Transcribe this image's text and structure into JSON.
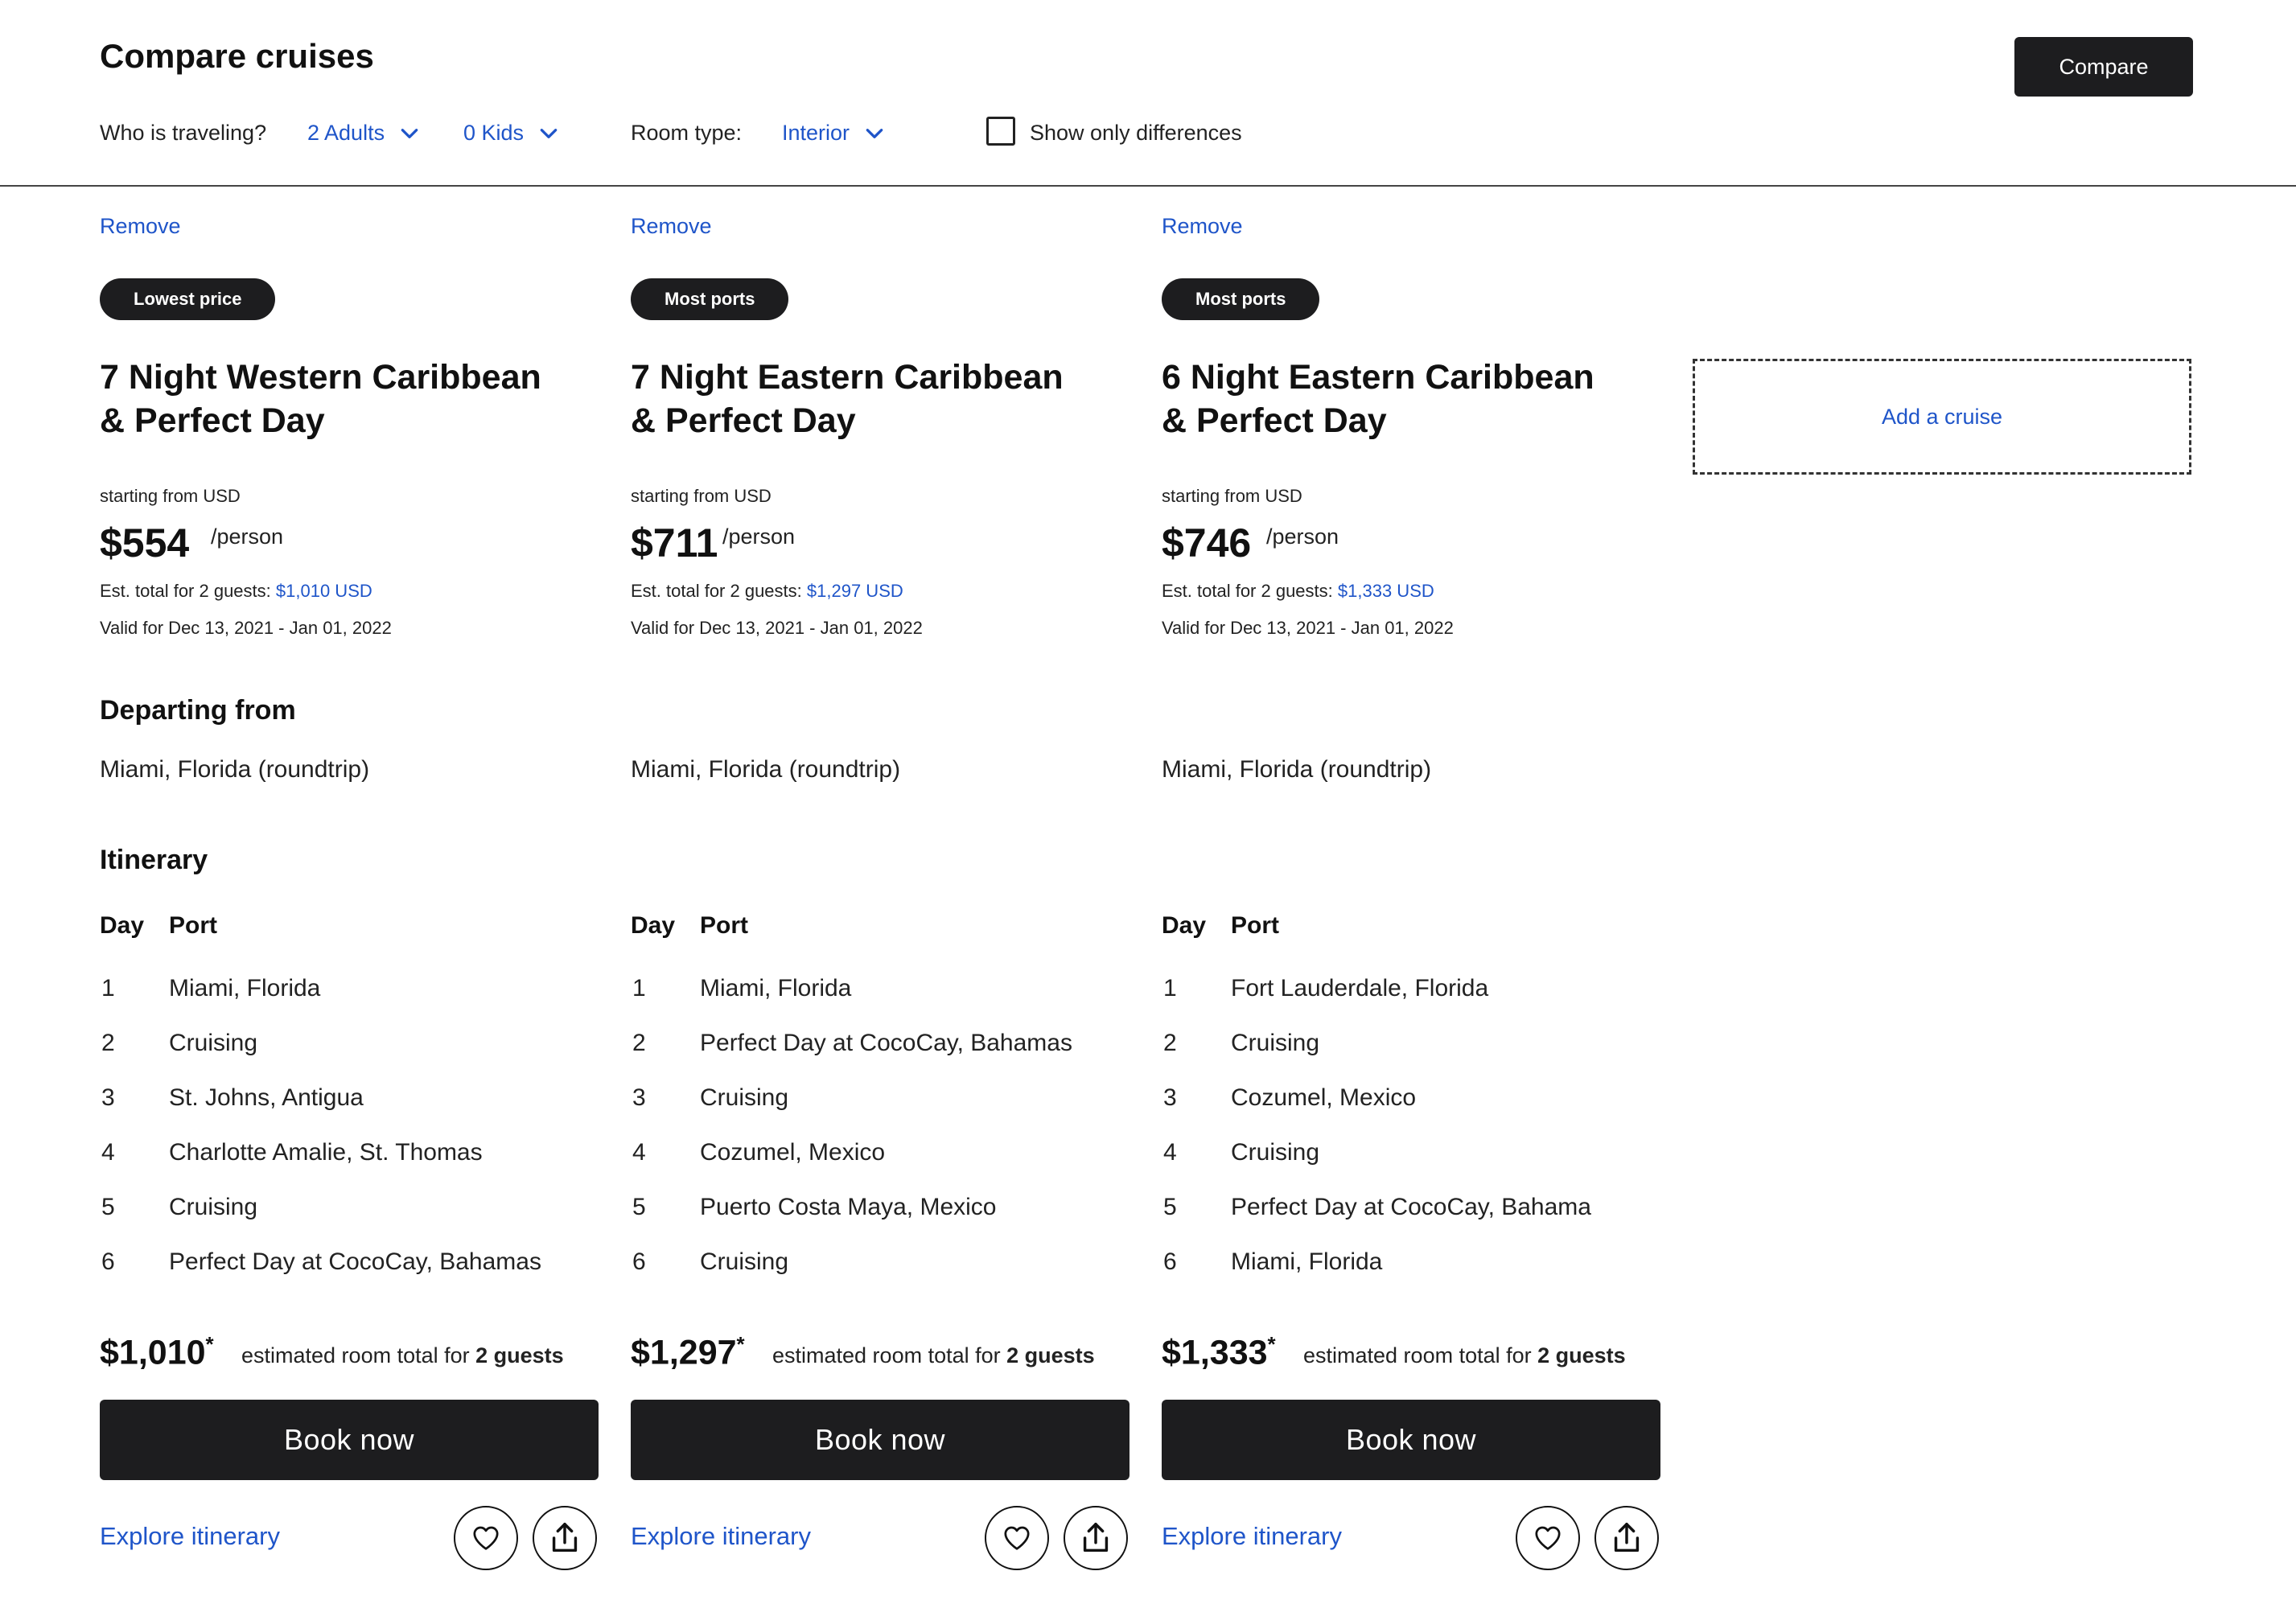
{
  "header": {
    "title": "Compare cruises",
    "compare_label": "Compare",
    "travelers_label": "Who is traveling?",
    "adults": "2 Adults",
    "kids": "0 Kids",
    "room_type_label": "Room type:",
    "room_type": "Interior",
    "differences_label": "Show only differences",
    "differences_checked": false
  },
  "labels": {
    "remove": "Remove",
    "starting_from": "starting from USD",
    "per_person": "/person",
    "est_total_prefix": "Est. total for 2 guests:",
    "departing_from": "Departing from",
    "itinerary": "Itinerary",
    "day": "Day",
    "port": "Port",
    "room_total_text": "estimated room total for",
    "guests": "2 guests",
    "book_now": "Book now",
    "explore": "Explore itinerary",
    "add_cruise": "Add a cruise"
  },
  "cruises": [
    {
      "badge": "Lowest price",
      "title_line1": "7 Night Western Caribbean",
      "title_line2": "& Perfect Day",
      "price": "$554",
      "est_total": "$1,010 USD",
      "valid": "Valid for Dec 13, 2021 - Jan 01, 2022",
      "departing": "Miami, Florida (roundtrip)",
      "itinerary": [
        {
          "day": "1",
          "port": "Miami, Florida"
        },
        {
          "day": "2",
          "port": "Cruising"
        },
        {
          "day": "3",
          "port": "St. Johns, Antigua"
        },
        {
          "day": "4",
          "port": "Charlotte Amalie, St. Thomas"
        },
        {
          "day": "5",
          "port": "Cruising"
        },
        {
          "day": "6",
          "port": "Perfect Day at CocoCay, Bahamas"
        }
      ],
      "room_total": "$1,010"
    },
    {
      "badge": "Most ports",
      "title_line1": "7 Night Eastern Caribbean",
      "title_line2": "& Perfect Day",
      "price": "$711",
      "est_total": "$1,297 USD",
      "valid": "Valid for Dec 13, 2021 - Jan 01, 2022",
      "departing": "Miami, Florida (roundtrip)",
      "itinerary": [
        {
          "day": "1",
          "port": "Miami, Florida"
        },
        {
          "day": "2",
          "port": "Perfect Day at CocoCay, Bahamas"
        },
        {
          "day": "3",
          "port": "Cruising"
        },
        {
          "day": "4",
          "port": "Cozumel, Mexico"
        },
        {
          "day": "5",
          "port": "Puerto Costa Maya, Mexico"
        },
        {
          "day": "6",
          "port": "Cruising"
        }
      ],
      "room_total": "$1,297"
    },
    {
      "badge": "Most ports",
      "title_line1": "6 Night Eastern Caribbean",
      "title_line2": "& Perfect Day",
      "price": "$746",
      "est_total": "$1,333 USD",
      "valid": "Valid for Dec 13, 2021 - Jan 01, 2022",
      "departing": "Miami, Florida (roundtrip)",
      "itinerary": [
        {
          "day": "1",
          "port": "Fort Lauderdale, Florida"
        },
        {
          "day": "2",
          "port": "Cruising"
        },
        {
          "day": "3",
          "port": "Cozumel, Mexico"
        },
        {
          "day": "4",
          "port": "Cruising"
        },
        {
          "day": "5",
          "port": "Perfect Day at CocoCay, Bahama"
        },
        {
          "day": "6",
          "port": "Miami, Florida"
        }
      ],
      "room_total": "$1,333"
    }
  ],
  "colors": {
    "accent_link": "#1f55c9",
    "button_dark": "#1d1d1f"
  },
  "icons": [
    "chevron-down-icon",
    "heart-icon",
    "share-icon"
  ]
}
